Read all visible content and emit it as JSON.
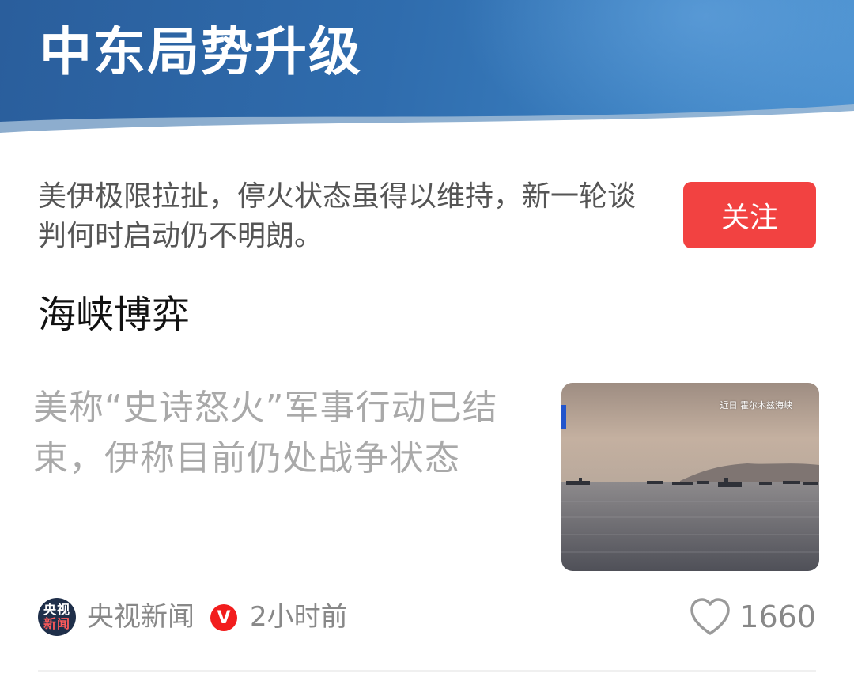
{
  "topic": {
    "title": "中东局势升级",
    "description": "美伊极限拉扯，停火状态虽得以维持，新一轮谈判何时启动仍不明朗。",
    "follow_label": "关注"
  },
  "section": {
    "heading": "海峡博弈"
  },
  "article": {
    "title": "美称“史诗怒火”军事行动已结束，伊称目前仍处战争状态",
    "thumbnail_caption": "近日 霍尔木兹海峡",
    "source": "央视新闻",
    "source_logo_top": "央视",
    "source_logo_bottom": "新闻",
    "verified_badge": "V",
    "time": "2小时前",
    "likes": "1660",
    "like_icon": "heart-outline-icon"
  },
  "colors": {
    "banner": "#2f6cad",
    "follow_button": "#f24241",
    "verified": "#f21d1d",
    "muted_text": "#888888"
  }
}
